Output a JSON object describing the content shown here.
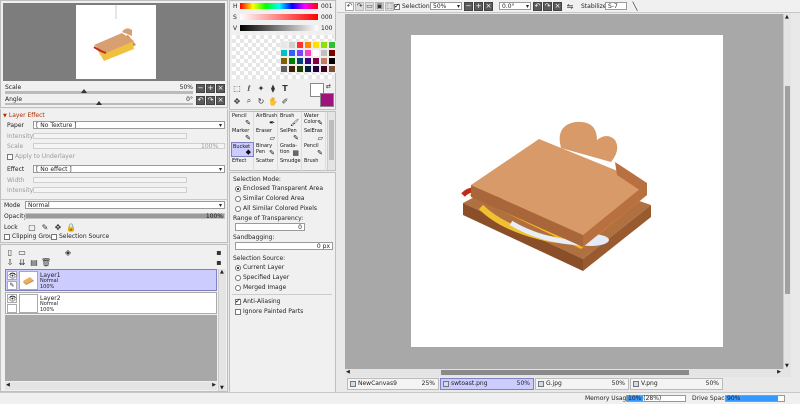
{
  "navigator": {
    "scale_label": "Scale",
    "scale_value": "50%",
    "angle_label": "Angle",
    "angle_value": "0°",
    "scale_buttons": [
      "−",
      "+",
      "×"
    ],
    "angle_buttons": [
      "↶",
      "↷",
      "×"
    ]
  },
  "layer_effect": {
    "header": "Layer Effect",
    "paper_label": "Paper",
    "paper_value": "[ No Texture ]",
    "intensity_label": "Intensity",
    "scale_label": "Scale",
    "scale_value": "100%",
    "apply_underlayer": "Apply to Underlayer",
    "effect_label": "Effect",
    "effect_value": "[ No effect ]",
    "width_label": "Width",
    "effect_intensity_label": "Intensity"
  },
  "layer_props": {
    "mode_label": "Mode",
    "mode_value": "Normal",
    "opacity_label": "Opacity",
    "opacity_value": "100%",
    "opacity_fraction": 1.0,
    "lock_label": "Lock",
    "clipping_group": "Clipping Group",
    "selection_source": "Selection Source"
  },
  "layers": [
    {
      "name": "Layer1",
      "mode": "Normal",
      "opacity": "100%",
      "selected": true
    },
    {
      "name": "Layer2",
      "mode": "Normal",
      "opacity": "100%",
      "selected": false
    }
  ],
  "color": {
    "h_label": "H",
    "h_value": "001",
    "s_label": "S",
    "s_value": "000",
    "v_label": "V",
    "v_value": "100",
    "palette": [
      "#e8e8e8",
      "#d0d0d0",
      "#ff3030",
      "#ff8a00",
      "#ffe000",
      "#90e000",
      "#30c030",
      "#00c0c0",
      "#3060ff",
      "#8040ff",
      "#ff40c0",
      "#ffffff",
      "#c0c0c0",
      "#800000",
      "#806000",
      "#008000",
      "#004080",
      "#400080",
      "#800040",
      "#c08060",
      "#000000",
      "#606060",
      "#402000",
      "#204000",
      "#002040",
      "#200040",
      "#400020",
      "#805030"
    ],
    "main_color": "#ffffff",
    "sub_color": "#a0127c"
  },
  "tools": [
    {
      "name": "Pencil",
      "glyph": "✎"
    },
    {
      "name": "AirBrush",
      "glyph": "✒"
    },
    {
      "name": "Brush",
      "glyph": "🖌"
    },
    {
      "name": "Water Color",
      "glyph": "✎"
    },
    {
      "name": "Marker",
      "glyph": "✎"
    },
    {
      "name": "Eraser",
      "glyph": "▱"
    },
    {
      "name": "SelPen",
      "glyph": "✎"
    },
    {
      "name": "SelEras",
      "glyph": "▱"
    },
    {
      "name": "Bucket",
      "glyph": "◆"
    },
    {
      "name": "Binary Pen",
      "glyph": "✎"
    },
    {
      "name": "Grada-tion",
      "glyph": "▦"
    },
    {
      "name": "Pencil",
      "glyph": "✎"
    },
    {
      "name": "Effect",
      "glyph": ""
    },
    {
      "name": "Scatter",
      "glyph": ""
    },
    {
      "name": "Smudge",
      "glyph": ""
    },
    {
      "name": "Brush",
      "glyph": ""
    }
  ],
  "tool_options": {
    "selection_mode_label": "Selection Mode:",
    "modes": [
      "Enclosed Transparent Area",
      "Similar Colored Area",
      "All Similar Colored Pixels"
    ],
    "range_label": "Range of Transparency:",
    "range_value": "0",
    "sandbagging_label": "Sandbagging:",
    "sandbagging_value": "0 px",
    "selection_source_label": "Selection Source:",
    "sources": [
      "Current Layer",
      "Specified Layer",
      "Merged Image"
    ],
    "anti_aliasing": "Anti-Aliasing",
    "ignore_painted": "Ignore Painted Parts"
  },
  "toolbar": {
    "selection_label": "Selection",
    "zoom_value": "50%",
    "rotation_value": "0.0°",
    "stabilizer_label": "Stabilizer",
    "stabilizer_value": "S-7"
  },
  "documents": [
    {
      "name": "NewCanvas9",
      "zoom": "25%",
      "active": false
    },
    {
      "name": "swtoast.png",
      "zoom": "50%",
      "active": true
    },
    {
      "name": "G.jpg",
      "zoom": "50%",
      "active": false
    },
    {
      "name": "V.png",
      "zoom": "50%",
      "active": false
    }
  ],
  "status": {
    "memory_label": "Memory Usage",
    "memory_value": "10% (28%)",
    "memory_fraction": 0.28,
    "drive_label": "Drive Space",
    "drive_value": "90%",
    "drive_fraction": 0.9
  },
  "colors": {
    "accent": "#3399ff",
    "selected_row": "#ccccff",
    "canvas_bg": "#a8a8a8"
  }
}
